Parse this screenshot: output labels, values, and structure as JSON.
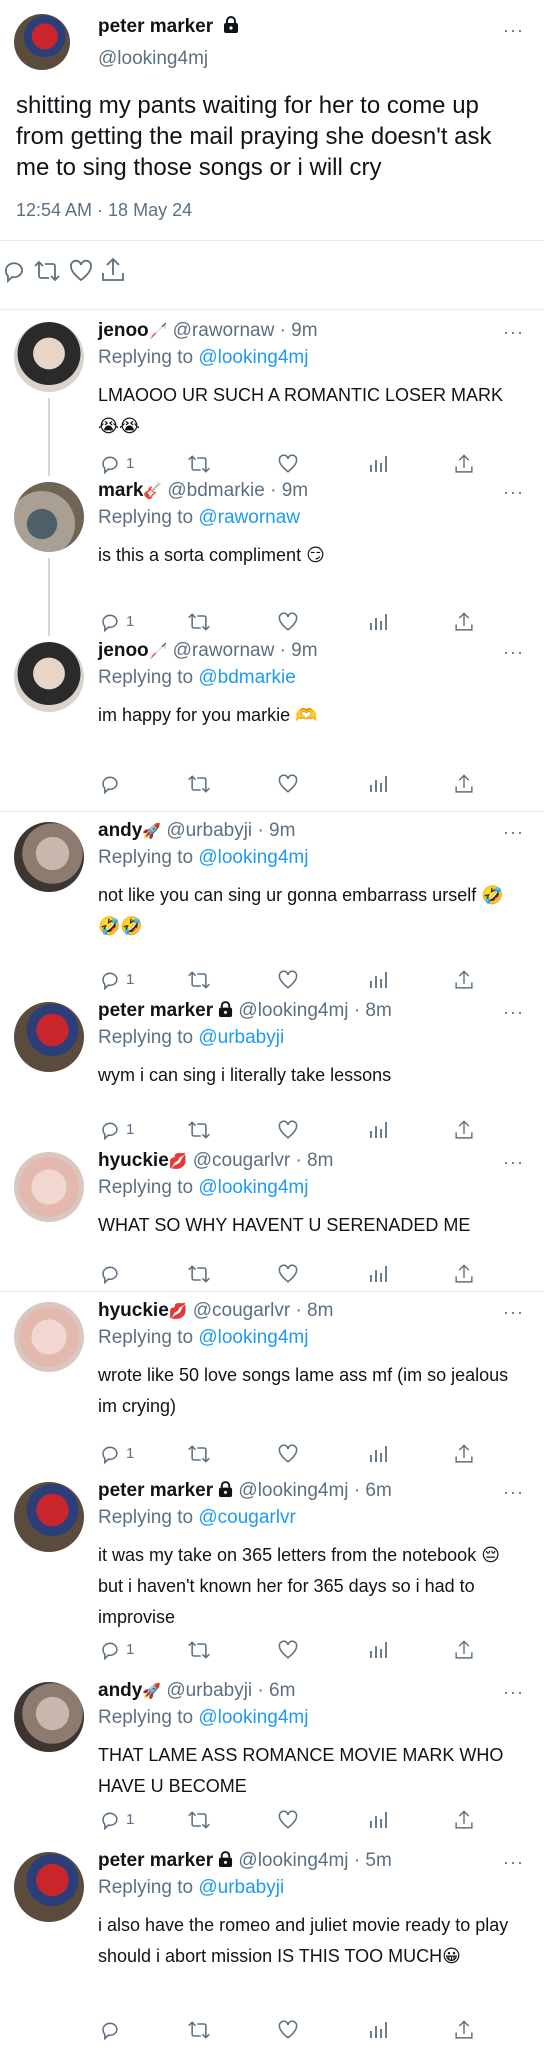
{
  "main_tweet": {
    "name": "peter marker",
    "handle": "@looking4mj",
    "text": "shitting my pants waiting for her to come up from getting the mail praying she doesn't ask me to sing those songs or i will cry",
    "timestamp": "12:54 AM · 18 May 24",
    "more": "···"
  },
  "replies": [
    {
      "name": "jenoo",
      "badge": "🦯",
      "handle": "@rawornaw",
      "time": "· 9m",
      "replying_prefix": "Replying to ",
      "replying_to": "@looking4mj",
      "text": "LMAOOO UR SUCH A ROMANTIC LOSER MARK 😭😭",
      "reply_count": "1",
      "more": "···"
    },
    {
      "name": "mark",
      "badge": "🎸",
      "handle": "@bdmarkie",
      "time": "· 9m",
      "replying_prefix": "Replying to ",
      "replying_to": "@rawornaw",
      "text": "is this a sorta compliment 😏",
      "reply_count": "1",
      "more": "···"
    },
    {
      "name": "jenoo",
      "badge": "🦯",
      "handle": "@rawornaw",
      "time": "· 9m",
      "replying_prefix": "Replying to ",
      "replying_to": "@bdmarkie",
      "text": "im happy for you markie 🫶",
      "reply_count": "",
      "more": "···"
    },
    {
      "name": "andy",
      "badge": "🚀",
      "handle": "@urbabyji",
      "time": "· 9m",
      "replying_prefix": "Replying to ",
      "replying_to": "@looking4mj",
      "text": "not like you can sing ur gonna embarrass urself 🤣🤣🤣",
      "reply_count": "1",
      "more": "···"
    },
    {
      "name": "peter marker",
      "badge": "",
      "handle": "@looking4mj",
      "time": "· 8m",
      "replying_prefix": "Replying to ",
      "replying_to": "@urbabyji",
      "text": "wym i can sing i literally take lessons",
      "reply_count": "1",
      "more": "···"
    },
    {
      "name": "hyuckie",
      "badge": "💋",
      "handle": "@cougarlvr",
      "time": "· 8m",
      "replying_prefix": "Replying to ",
      "replying_to": "@looking4mj",
      "text": "WHAT SO WHY HAVENT U SERENADED ME",
      "reply_count": "",
      "more": "···"
    },
    {
      "name": "hyuckie",
      "badge": "💋",
      "handle": "@cougarlvr",
      "time": "· 8m",
      "replying_prefix": "Replying to ",
      "replying_to": "@looking4mj",
      "text": "wrote like 50 love songs lame ass mf (im so jealous im crying)",
      "reply_count": "1",
      "more": "···"
    },
    {
      "name": "peter marker",
      "badge": "",
      "handle": "@looking4mj",
      "time": "· 6m",
      "replying_prefix": "Replying to ",
      "replying_to": "@cougarlvr",
      "text": "it was my take on 365 letters from the notebook 😔 but i haven't known her for 365 days so i had to improvise",
      "reply_count": "1",
      "more": "···"
    },
    {
      "name": "andy",
      "badge": "🚀",
      "handle": "@urbabyji",
      "time": "· 6m",
      "replying_prefix": "Replying to ",
      "replying_to": "@looking4mj",
      "text": "THAT LAME ASS ROMANCE MOVIE MARK WHO HAVE U BECOME",
      "reply_count": "1",
      "more": "···"
    },
    {
      "name": "peter marker",
      "badge": "",
      "handle": "@looking4mj",
      "time": "· 5m",
      "replying_prefix": "Replying to ",
      "replying_to": "@urbabyji",
      "text": "i also have the romeo and juliet movie ready to play should i abort mission IS THIS TOO MUCH😀",
      "reply_count": "",
      "more": "···"
    }
  ],
  "icons": {
    "reply": "reply-icon",
    "retweet": "retweet-icon",
    "like": "heart-icon",
    "analytics": "analytics-icon",
    "share": "share-icon",
    "lock": "lock-icon",
    "more": "more-icon"
  }
}
